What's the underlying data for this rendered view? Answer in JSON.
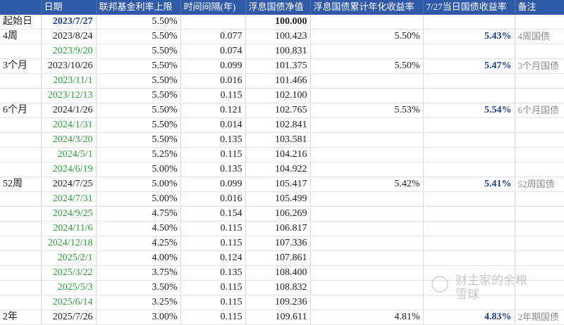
{
  "headers": [
    "",
    "日期",
    "联邦基金利率上限",
    "时间间隔(年)",
    "浮息国债净值",
    "浮息国债累计年化收益率",
    "7/27当日国债收益率",
    "备注"
  ],
  "rows": [
    {
      "label": "起始日",
      "date": "2023/7/27",
      "rate": "5.50%",
      "interval": "",
      "nav": "100.000",
      "cum": "",
      "yield": "",
      "note": "",
      "thick": false,
      "date_style": "date-blue",
      "nav_bold": true
    },
    {
      "label": "4周",
      "date": "2023/8/24",
      "rate": "5.50%",
      "interval": "0.077",
      "nav": "100.423",
      "cum": "5.50%",
      "yield": "5.43%",
      "note": "4周国债",
      "thick": true,
      "date_style": "",
      "nav_bold": false
    },
    {
      "label": "",
      "date": "2023/9/20",
      "rate": "5.50%",
      "interval": "0.074",
      "nav": "100.831",
      "cum": "",
      "yield": "",
      "note": "",
      "thick": false,
      "date_style": "green",
      "nav_bold": false
    },
    {
      "label": "3个月",
      "date": "2023/10/26",
      "rate": "5.50%",
      "interval": "0.099",
      "nav": "101.375",
      "cum": "5.50%",
      "yield": "5.47%",
      "note": "3个月国债",
      "thick": true,
      "date_style": "",
      "nav_bold": false
    },
    {
      "label": "",
      "date": "2023/11/1",
      "rate": "5.50%",
      "interval": "0.016",
      "nav": "101.466",
      "cum": "",
      "yield": "",
      "note": "",
      "thick": false,
      "date_style": "green",
      "nav_bold": false
    },
    {
      "label": "",
      "date": "2023/12/13",
      "rate": "5.50%",
      "interval": "0.115",
      "nav": "102.100",
      "cum": "",
      "yield": "",
      "note": "",
      "thick": false,
      "date_style": "green",
      "nav_bold": false
    },
    {
      "label": "6个月",
      "date": "2024/1/26",
      "rate": "5.50%",
      "interval": "0.121",
      "nav": "102.765",
      "cum": "5.53%",
      "yield": "5.54%",
      "note": "6个月国债",
      "thick": true,
      "date_style": "",
      "nav_bold": false
    },
    {
      "label": "",
      "date": "2024/1/31",
      "rate": "5.50%",
      "interval": "0.014",
      "nav": "102.841",
      "cum": "",
      "yield": "",
      "note": "",
      "thick": false,
      "date_style": "green",
      "nav_bold": false
    },
    {
      "label": "",
      "date": "2024/3/20",
      "rate": "5.50%",
      "interval": "0.135",
      "nav": "103.581",
      "cum": "",
      "yield": "",
      "note": "",
      "thick": false,
      "date_style": "green",
      "nav_bold": false
    },
    {
      "label": "",
      "date": "2024/5/1",
      "rate": "5.25%",
      "interval": "0.115",
      "nav": "104.216",
      "cum": "",
      "yield": "",
      "note": "",
      "thick": false,
      "date_style": "green",
      "nav_bold": false
    },
    {
      "label": "",
      "date": "2024/6/19",
      "rate": "5.00%",
      "interval": "0.135",
      "nav": "104.922",
      "cum": "",
      "yield": "",
      "note": "",
      "thick": false,
      "date_style": "green",
      "nav_bold": false
    },
    {
      "label": "52周",
      "date": "2024/7/25",
      "rate": "5.00%",
      "interval": "0.099",
      "nav": "105.417",
      "cum": "5.42%",
      "yield": "5.41%",
      "note": "52周国债",
      "thick": true,
      "date_style": "",
      "nav_bold": false
    },
    {
      "label": "",
      "date": "2024/7/31",
      "rate": "5.00%",
      "interval": "0.016",
      "nav": "105.499",
      "cum": "",
      "yield": "",
      "note": "",
      "thick": false,
      "date_style": "green",
      "nav_bold": false
    },
    {
      "label": "",
      "date": "2024/9/25",
      "rate": "4.75%",
      "interval": "0.154",
      "nav": "106.269",
      "cum": "",
      "yield": "",
      "note": "",
      "thick": false,
      "date_style": "green",
      "nav_bold": false
    },
    {
      "label": "",
      "date": "2024/11/6",
      "rate": "4.50%",
      "interval": "0.115",
      "nav": "106.817",
      "cum": "",
      "yield": "",
      "note": "",
      "thick": false,
      "date_style": "green",
      "nav_bold": false
    },
    {
      "label": "",
      "date": "2024/12/18",
      "rate": "4.25%",
      "interval": "0.115",
      "nav": "107.336",
      "cum": "",
      "yield": "",
      "note": "",
      "thick": false,
      "date_style": "green",
      "nav_bold": false
    },
    {
      "label": "",
      "date": "2025/2/1",
      "rate": "4.00%",
      "interval": "0.124",
      "nav": "107.861",
      "cum": "",
      "yield": "",
      "note": "",
      "thick": false,
      "date_style": "green",
      "nav_bold": false
    },
    {
      "label": "",
      "date": "2025/3/22",
      "rate": "3.75%",
      "interval": "0.135",
      "nav": "108.400",
      "cum": "",
      "yield": "",
      "note": "",
      "thick": false,
      "date_style": "green",
      "nav_bold": false
    },
    {
      "label": "",
      "date": "2025/5/3",
      "rate": "3.50%",
      "interval": "0.115",
      "nav": "108.832",
      "cum": "",
      "yield": "",
      "note": "",
      "thick": false,
      "date_style": "green",
      "nav_bold": false
    },
    {
      "label": "",
      "date": "2025/6/14",
      "rate": "3.25%",
      "interval": "0.115",
      "nav": "109.236",
      "cum": "",
      "yield": "",
      "note": "",
      "thick": false,
      "date_style": "green",
      "nav_bold": false
    },
    {
      "label": "2年",
      "date": "2025/7/26",
      "rate": "3.00%",
      "interval": "0.115",
      "nav": "109.611",
      "cum": "4.81%",
      "yield": "4.83%",
      "note": "2年期国债",
      "thick": true,
      "date_style": "",
      "nav_bold": false
    }
  ],
  "watermark": {
    "line1": "财主家的余粮",
    "line2": "雪球"
  }
}
